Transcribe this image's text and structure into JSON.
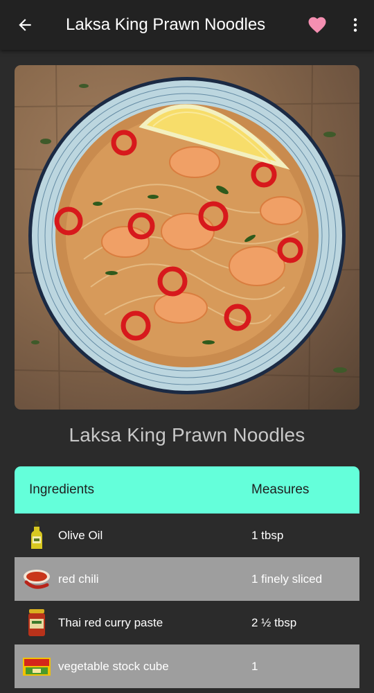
{
  "appbar": {
    "title": "Laksa King Prawn Noodles",
    "back_icon": "arrow-back-icon",
    "favorite_icon": "heart-icon",
    "favorite_color": "#f48fb1",
    "more_icon": "more-vert-icon"
  },
  "recipe": {
    "title": "Laksa King Prawn Noodles"
  },
  "table": {
    "header_color": "#64ffda",
    "headers": {
      "ingredients": "Ingredients",
      "measures": "Measures"
    },
    "rows": [
      {
        "name": "Olive Oil",
        "measure": "1 tbsp",
        "icon": "olive-oil-bottle-icon"
      },
      {
        "name": "red chili",
        "measure": "1 finely sliced",
        "icon": "red-chili-icon"
      },
      {
        "name": "Thai red curry paste",
        "measure": "2 ½ tbsp",
        "icon": "curry-paste-jar-icon"
      },
      {
        "name": "vegetable stock cube",
        "measure": "1",
        "icon": "stock-cube-icon"
      }
    ]
  }
}
